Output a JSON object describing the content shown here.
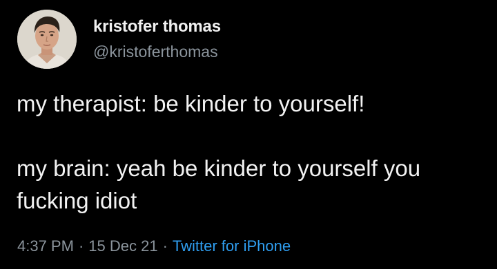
{
  "tweet": {
    "author": {
      "display_name": "kristofer thomas",
      "handle": "@kristoferthomas"
    },
    "text_line_1": "my therapist: be kinder to yourself!",
    "text_line_2": "my brain: yeah be kinder to yourself you fucking idiot",
    "time": "4:37 PM",
    "separator": "·",
    "date": "15 Dec 21",
    "source": "Twitter for iPhone"
  },
  "colors": {
    "background": "#000000",
    "text": "#f2f2f2",
    "muted": "#8b949c",
    "link": "#2f9ef0"
  }
}
